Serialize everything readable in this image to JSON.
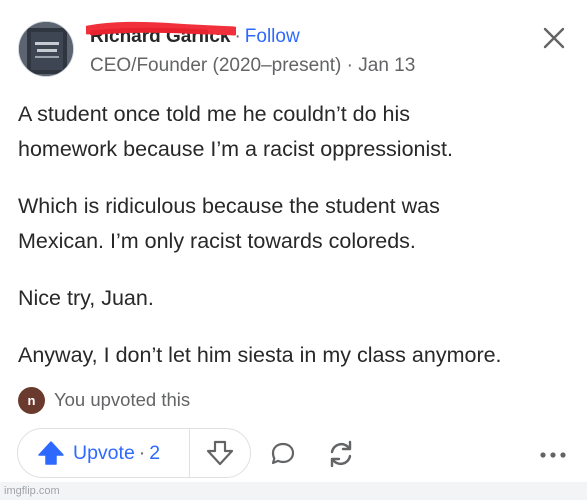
{
  "post": {
    "author_name": "Richard Garlick",
    "separator": "·",
    "follow_label": "Follow",
    "credential": "CEO/Founder (2020–present)",
    "date_separator": "·",
    "date": "Jan 13",
    "paragraphs": [
      [
        "A student once told me he couldn’t do his",
        "homework because I’m a racist oppressionist."
      ],
      [
        "Which is ridiculous because the student was",
        "Mexican. I’m only racist towards coloreds."
      ],
      [
        "Nice try, Juan."
      ],
      [
        "Anyway, I don’t let him siesta in my class anymore."
      ]
    ]
  },
  "upvoted": {
    "avatar_letter": "n",
    "text": "You upvoted this"
  },
  "actions": {
    "upvote_label": "Upvote",
    "count_separator": "·",
    "upvote_count": "2"
  },
  "icons": {
    "close": "close-icon",
    "upvote": "upvote-arrow-icon",
    "downvote": "downvote-arrow-icon",
    "comment": "comment-icon",
    "share": "share-icon",
    "more": "more-icon"
  },
  "colors": {
    "accent": "#2e69ff",
    "text": "#282829",
    "muted": "#636466",
    "redaction": "#f0303a"
  },
  "watermark": "imgflip.com"
}
